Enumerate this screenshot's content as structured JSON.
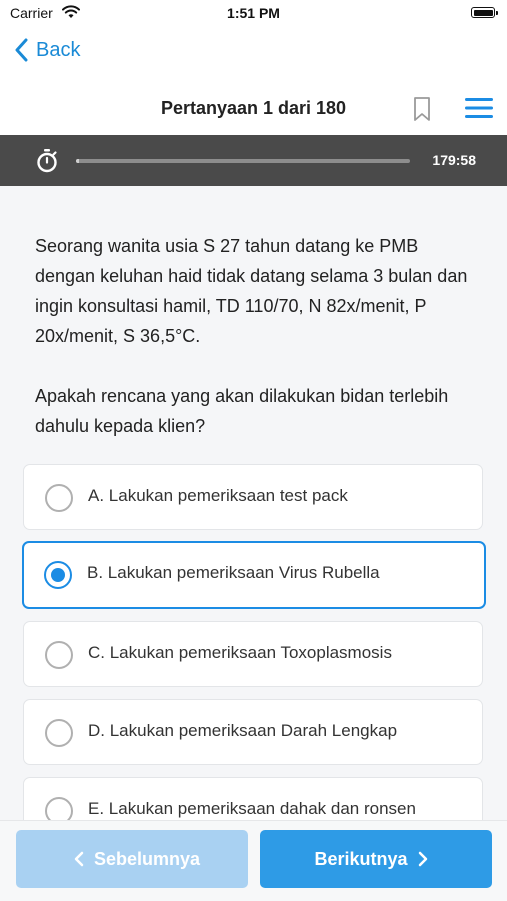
{
  "status_bar": {
    "carrier": "Carrier",
    "time": "1:51 PM"
  },
  "nav": {
    "back_label": "Back",
    "title": "Pertanyaan 1 dari 180",
    "icons": [
      "chevron-left-icon",
      "bookmark-icon",
      "hamburger-menu-icon"
    ]
  },
  "timer": {
    "remaining": "179:58",
    "progress_fraction": 0.01
  },
  "question": {
    "paragraph1": "Seorang wanita usia S 27 tahun datang ke PMB dengan keluhan haid tidak datang selama 3 bulan dan ingin konsultasi hamil, TD  110/70, N 82x/menit, P 20x/menit, S 36,5°C.",
    "paragraph2": "Apakah rencana yang akan dilakukan bidan terlebih dahulu kepada klien?"
  },
  "options": [
    {
      "label": "A. Lakukan pemeriksaan test pack",
      "selected": false
    },
    {
      "label": "B. Lakukan pemeriksaan Virus Rubella",
      "selected": true
    },
    {
      "label": "C. Lakukan pemeriksaan Toxoplasmosis",
      "selected": false
    },
    {
      "label": "D. Lakukan pemeriksaan Darah Lengkap",
      "selected": false
    },
    {
      "label": "E. Lakukan pemeriksaan dahak dan ronsen",
      "selected": false
    }
  ],
  "footer": {
    "prev_label": "Sebelumnya",
    "next_label": "Berikutnya"
  },
  "colors": {
    "accent": "#1b8ce4",
    "timer_bar": "#4a4a4a",
    "next_button": "#2e9be6",
    "prev_button": "#a9d1f2"
  }
}
